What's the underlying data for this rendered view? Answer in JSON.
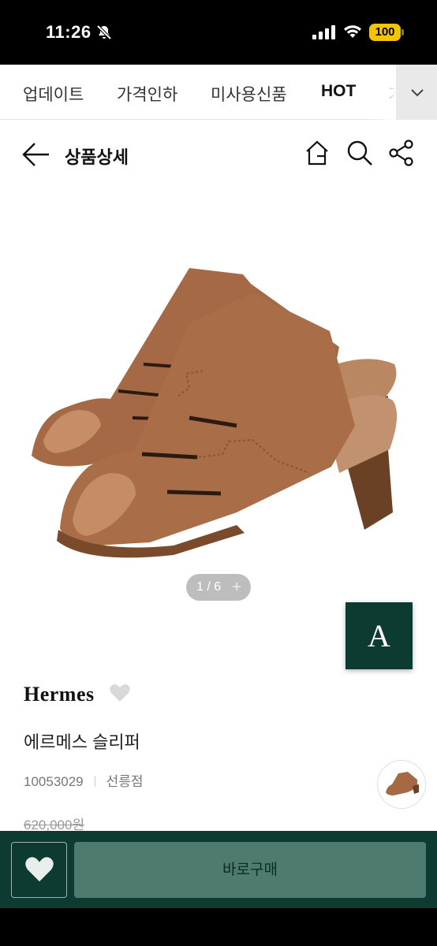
{
  "status": {
    "time": "11:26",
    "battery": "100"
  },
  "categories": [
    {
      "label": "업데이트"
    },
    {
      "label": "가격인하"
    },
    {
      "label": "미사용신품"
    },
    {
      "label": "HOT"
    },
    {
      "label": "가"
    }
  ],
  "header": {
    "title": "상품상세"
  },
  "gallery": {
    "pager": "1 / 6",
    "pager_plus": "+"
  },
  "brand_badge": "A",
  "product": {
    "brand": "Hermes",
    "title": "에르메스 슬리퍼",
    "code": "10053029",
    "store": "선릉점",
    "original_price": "620,000원"
  },
  "actions": {
    "buy_label": "바로구매"
  },
  "colors": {
    "brand_green": "#0d3b32",
    "buy_button": "#4f7a70",
    "shoe_tan": "#a56a45"
  },
  "icons": [
    "bell-off-icon",
    "signal-icon",
    "wifi-icon",
    "chevron-down-icon",
    "back-arrow-icon",
    "home-icon",
    "search-icon",
    "share-icon",
    "heart-icon"
  ]
}
